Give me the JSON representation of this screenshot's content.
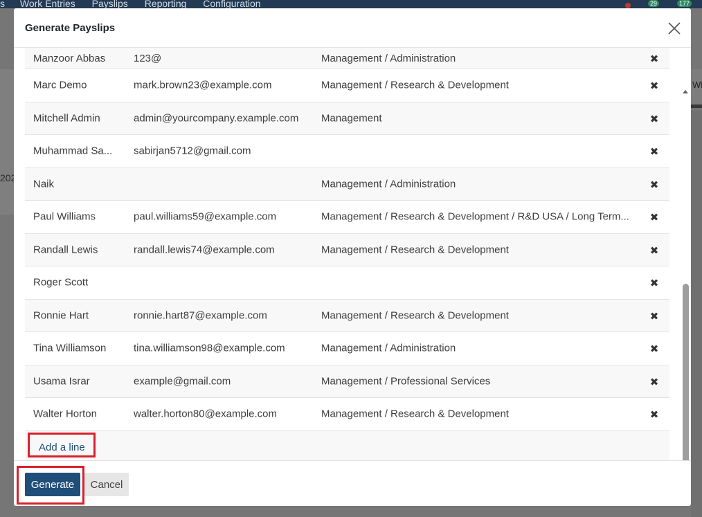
{
  "background": {
    "menu_items": [
      "s",
      "Work Entries",
      "Payslips",
      "Reporting",
      "Configuration"
    ],
    "badges": [
      "29",
      "177"
    ],
    "right_strip_text": "Wh",
    "left_text": "202"
  },
  "modal": {
    "title": "Generate Payslips",
    "close_icon": "close-icon",
    "rows": [
      {
        "name": "Manzoor Abbas",
        "email": "123@",
        "department": "Management / Administration"
      },
      {
        "name": "Marc Demo",
        "email": "mark.brown23@example.com",
        "department": "Management / Research & Development"
      },
      {
        "name": "Mitchell Admin",
        "email": "admin@yourcompany.example.com",
        "department": "Management"
      },
      {
        "name": "Muhammad Sa...",
        "email": "sabirjan5712@gmail.com",
        "department": ""
      },
      {
        "name": "Naik",
        "email": "",
        "department": "Management / Administration"
      },
      {
        "name": "Paul Williams",
        "email": "paul.williams59@example.com",
        "department": "Management / Research & Development / R&D USA / Long Term..."
      },
      {
        "name": "Randall Lewis",
        "email": "randall.lewis74@example.com",
        "department": "Management / Research & Development"
      },
      {
        "name": "Roger Scott",
        "email": "",
        "department": ""
      },
      {
        "name": "Ronnie Hart",
        "email": "ronnie.hart87@example.com",
        "department": "Management / Research & Development"
      },
      {
        "name": "Tina Williamson",
        "email": "tina.williamson98@example.com",
        "department": "Management / Administration"
      },
      {
        "name": "Usama Israr",
        "email": "example@gmail.com",
        "department": "Management / Professional Services"
      },
      {
        "name": "Walter Horton",
        "email": "walter.horton80@example.com",
        "department": "Management / Research & Development"
      }
    ],
    "delete_glyph": "✖",
    "add_line_label": "Add a line",
    "generate_label": "Generate",
    "cancel_label": "Cancel"
  },
  "colors": {
    "primary": "#1f4e79",
    "highlight": "#d7202a"
  }
}
